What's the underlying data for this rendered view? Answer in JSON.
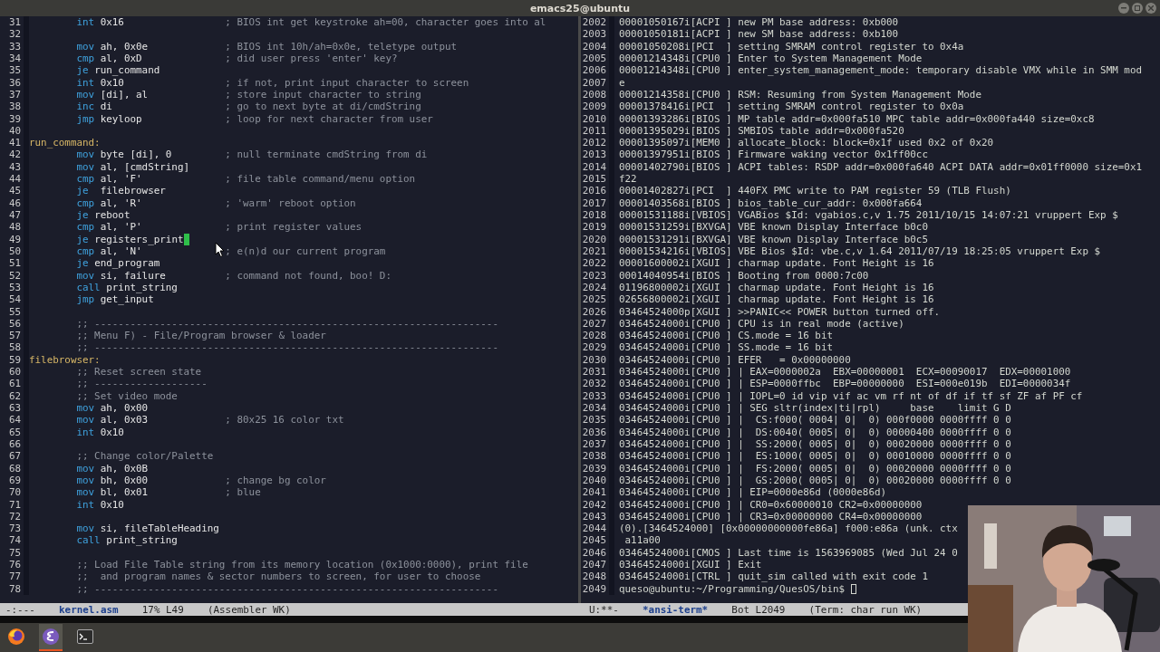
{
  "window": {
    "title": "emacs25@ubuntu"
  },
  "editor": {
    "lines": [
      {
        "n": "31",
        "kind": "code",
        "op": "int",
        "args": "0x16",
        "comment": "; BIOS int get keystroke ah=00, character goes into al"
      },
      {
        "n": "32",
        "kind": "blank"
      },
      {
        "n": "33",
        "kind": "code",
        "op": "mov",
        "args": "ah, 0x0e",
        "comment": "; BIOS int 10h/ah=0x0e, teletype output"
      },
      {
        "n": "34",
        "kind": "code",
        "op": "cmp",
        "args": "al, 0xD",
        "comment": "; did user press 'enter' key?"
      },
      {
        "n": "35",
        "kind": "code",
        "op": "je",
        "args": "run_command"
      },
      {
        "n": "36",
        "kind": "code",
        "op": "int",
        "args": "0x10",
        "comment": "; if not, print input character to screen"
      },
      {
        "n": "37",
        "kind": "code",
        "op": "mov",
        "args": "[di], al",
        "comment": "; store input character to string"
      },
      {
        "n": "38",
        "kind": "code",
        "op": "inc",
        "args": "di",
        "comment": "; go to next byte at di/cmdString"
      },
      {
        "n": "39",
        "kind": "code",
        "op": "jmp",
        "args": "keyloop",
        "comment": "; loop for next character from user"
      },
      {
        "n": "40",
        "kind": "blank"
      },
      {
        "n": "41",
        "kind": "label",
        "text": "run_command:"
      },
      {
        "n": "42",
        "kind": "code",
        "op": "mov",
        "args": "byte [di], 0",
        "comment": "; null terminate cmdString from di"
      },
      {
        "n": "43",
        "kind": "code",
        "op": "mov",
        "args": "al, [cmdString]"
      },
      {
        "n": "44",
        "kind": "code",
        "op": "cmp",
        "args": "al, 'F'",
        "comment": "; file table command/menu option"
      },
      {
        "n": "45",
        "kind": "code",
        "op": "je",
        "args": " filebrowser"
      },
      {
        "n": "46",
        "kind": "code",
        "op": "cmp",
        "args": "al, 'R'",
        "comment": "; 'warm' reboot option"
      },
      {
        "n": "47",
        "kind": "code",
        "op": "je",
        "args": "reboot"
      },
      {
        "n": "48",
        "kind": "code",
        "op": "cmp",
        "args": "al, 'P'",
        "comment": "; print register values"
      },
      {
        "n": "49",
        "kind": "code",
        "op": "je",
        "args": "registers_print",
        "cursor": true
      },
      {
        "n": "50",
        "kind": "code",
        "op": "cmp",
        "args": "al, 'N'",
        "comment": "; e(n)d our current program"
      },
      {
        "n": "51",
        "kind": "code",
        "op": "je",
        "args": "end_program"
      },
      {
        "n": "52",
        "kind": "code",
        "op": "mov",
        "args": "si, failure",
        "comment": "; command not found, boo! D:"
      },
      {
        "n": "53",
        "kind": "code",
        "op": "call",
        "args": "print_string"
      },
      {
        "n": "54",
        "kind": "code",
        "op": "jmp",
        "args": "get_input"
      },
      {
        "n": "55",
        "kind": "blank"
      },
      {
        "n": "56",
        "kind": "comment",
        "text": ";; --------------------------------------------------------------------"
      },
      {
        "n": "57",
        "kind": "comment",
        "text": ";; Menu F) - File/Program browser & loader"
      },
      {
        "n": "58",
        "kind": "comment",
        "text": ";; --------------------------------------------------------------------"
      },
      {
        "n": "59",
        "kind": "label",
        "text": "filebrowser:"
      },
      {
        "n": "60",
        "kind": "comment",
        "text": ";; Reset screen state"
      },
      {
        "n": "61",
        "kind": "comment",
        "text": ";; -------------------"
      },
      {
        "n": "62",
        "kind": "comment",
        "text": ";; Set video mode"
      },
      {
        "n": "63",
        "kind": "code",
        "op": "mov",
        "args": "ah, 0x00"
      },
      {
        "n": "64",
        "kind": "code",
        "op": "mov",
        "args": "al, 0x03",
        "comment": "; 80x25 16 color txt"
      },
      {
        "n": "65",
        "kind": "code",
        "op": "int",
        "args": "0x10"
      },
      {
        "n": "66",
        "kind": "blank"
      },
      {
        "n": "67",
        "kind": "comment",
        "text": ";; Change color/Palette"
      },
      {
        "n": "68",
        "kind": "code",
        "op": "mov",
        "args": "ah, 0x0B"
      },
      {
        "n": "69",
        "kind": "code",
        "op": "mov",
        "args": "bh, 0x00",
        "comment": "; change bg color"
      },
      {
        "n": "70",
        "kind": "code",
        "op": "mov",
        "args": "bl, 0x01",
        "comment": "; blue"
      },
      {
        "n": "71",
        "kind": "code",
        "op": "int",
        "args": "0x10"
      },
      {
        "n": "72",
        "kind": "blank"
      },
      {
        "n": "73",
        "kind": "code",
        "op": "mov",
        "args": "si, fileTableHeading"
      },
      {
        "n": "74",
        "kind": "code",
        "op": "call",
        "args": "print_string"
      },
      {
        "n": "75",
        "kind": "blank"
      },
      {
        "n": "76",
        "kind": "comment",
        "text": ";; Load File Table string from its memory location (0x1000:0000), print file"
      },
      {
        "n": "77",
        "kind": "comment",
        "text": ";;  and program names & sector numbers to screen, for user to choose"
      },
      {
        "n": "78",
        "kind": "comment",
        "text": ";; --------------------------------------------------------------------"
      }
    ],
    "mode_line": {
      "status": "-:---",
      "buffer": "kernel.asm",
      "position": "17% L49",
      "mode": "(Assembler WK)"
    }
  },
  "terminal": {
    "lines": [
      {
        "n": "2002",
        "text": "00001050167i[ACPI ] new PM base address: 0xb000"
      },
      {
        "n": "2003",
        "text": "00001050181i[ACPI ] new SM base address: 0xb100"
      },
      {
        "n": "2004",
        "text": "00001050208i[PCI  ] setting SMRAM control register to 0x4a"
      },
      {
        "n": "2005",
        "text": "00001214348i[CPU0 ] Enter to System Management Mode"
      },
      {
        "n": "2006",
        "text": "00001214348i[CPU0 ] enter_system_management_mode: temporary disable VMX while in SMM mod"
      },
      {
        "n": "2007",
        "text": "e"
      },
      {
        "n": "2008",
        "text": "00001214358i[CPU0 ] RSM: Resuming from System Management Mode"
      },
      {
        "n": "2009",
        "text": "00001378416i[PCI  ] setting SMRAM control register to 0x0a"
      },
      {
        "n": "2010",
        "text": "00001393286i[BIOS ] MP table addr=0x000fa510 MPC table addr=0x000fa440 size=0xc8"
      },
      {
        "n": "2011",
        "text": "00001395029i[BIOS ] SMBIOS table addr=0x000fa520"
      },
      {
        "n": "2012",
        "text": "00001395097i[MEM0 ] allocate_block: block=0x1f used 0x2 of 0x20"
      },
      {
        "n": "2013",
        "text": "00001397951i[BIOS ] Firmware waking vector 0x1ff00cc"
      },
      {
        "n": "2014",
        "text": "00001402790i[BIOS ] ACPI tables: RSDP addr=0x000fa640 ACPI DATA addr=0x01ff0000 size=0x1"
      },
      {
        "n": "2015",
        "text": "f22"
      },
      {
        "n": "2016",
        "text": "00001402827i[PCI  ] 440FX PMC write to PAM register 59 (TLB Flush)"
      },
      {
        "n": "2017",
        "text": "00001403568i[BIOS ] bios_table_cur_addr: 0x000fa664"
      },
      {
        "n": "2018",
        "text": "00001531188i[VBIOS] VGABios $Id: vgabios.c,v 1.75 2011/10/15 14:07:21 vruppert Exp $"
      },
      {
        "n": "2019",
        "text": "00001531259i[BXVGA] VBE known Display Interface b0c0"
      },
      {
        "n": "2020",
        "text": "00001531291i[BXVGA] VBE known Display Interface b0c5"
      },
      {
        "n": "2021",
        "text": "00001534216i[VBIOS] VBE Bios $Id: vbe.c,v 1.64 2011/07/19 18:25:05 vruppert Exp $"
      },
      {
        "n": "2022",
        "text": "00001600002i[XGUI ] charmap update. Font Height is 16"
      },
      {
        "n": "2023",
        "text": "00014040954i[BIOS ] Booting from 0000:7c00"
      },
      {
        "n": "2024",
        "text": "01196800002i[XGUI ] charmap update. Font Height is 16"
      },
      {
        "n": "2025",
        "text": "02656800002i[XGUI ] charmap update. Font Height is 16"
      },
      {
        "n": "2026",
        "text": "03464524000p[XGUI ] >>PANIC<< POWER button turned off."
      },
      {
        "n": "2027",
        "text": "03464524000i[CPU0 ] CPU is in real mode (active)"
      },
      {
        "n": "2028",
        "text": "03464524000i[CPU0 ] CS.mode = 16 bit"
      },
      {
        "n": "2029",
        "text": "03464524000i[CPU0 ] SS.mode = 16 bit"
      },
      {
        "n": "2030",
        "text": "03464524000i[CPU0 ] EFER   = 0x00000000"
      },
      {
        "n": "2031",
        "text": "03464524000i[CPU0 ] | EAX=0000002a  EBX=00000001  ECX=00090017  EDX=00001000"
      },
      {
        "n": "2032",
        "text": "03464524000i[CPU0 ] | ESP=0000ffbc  EBP=00000000  ESI=000e019b  EDI=0000034f"
      },
      {
        "n": "2033",
        "text": "03464524000i[CPU0 ] | IOPL=0 id vip vif ac vm rf nt of df if tf sf ZF af PF cf"
      },
      {
        "n": "2034",
        "text": "03464524000i[CPU0 ] | SEG sltr(index|ti|rpl)     base    limit G D"
      },
      {
        "n": "2035",
        "text": "03464524000i[CPU0 ] |  CS:f000( 0004| 0|  0) 000f0000 0000ffff 0 0"
      },
      {
        "n": "2036",
        "text": "03464524000i[CPU0 ] |  DS:0040( 0005| 0|  0) 00000400 0000ffff 0 0"
      },
      {
        "n": "2037",
        "text": "03464524000i[CPU0 ] |  SS:2000( 0005| 0|  0) 00020000 0000ffff 0 0"
      },
      {
        "n": "2038",
        "text": "03464524000i[CPU0 ] |  ES:1000( 0005| 0|  0) 00010000 0000ffff 0 0"
      },
      {
        "n": "2039",
        "text": "03464524000i[CPU0 ] |  FS:2000( 0005| 0|  0) 00020000 0000ffff 0 0"
      },
      {
        "n": "2040",
        "text": "03464524000i[CPU0 ] |  GS:2000( 0005| 0|  0) 00020000 0000ffff 0 0"
      },
      {
        "n": "2041",
        "text": "03464524000i[CPU0 ] | EIP=0000e86d (0000e86d)"
      },
      {
        "n": "2042",
        "text": "03464524000i[CPU0 ] | CR0=0x60000010 CR2=0x00000000"
      },
      {
        "n": "2043",
        "text": "03464524000i[CPU0 ] | CR3=0x00000000 CR4=0x00000000"
      },
      {
        "n": "2044",
        "text": "(0).[3464524000] [0x00000000000fe86a] f000:e86a (unk. ctx"
      },
      {
        "n": "2045",
        "text": " a11a00"
      },
      {
        "n": "2046",
        "text": "03464524000i[CMOS ] Last time is 1563969085 (Wed Jul 24 0"
      },
      {
        "n": "2047",
        "text": "03464524000i[XGUI ] Exit"
      },
      {
        "n": "2048",
        "text": "03464524000i[CTRL ] quit_sim called with exit code 1"
      },
      {
        "n": "2049",
        "text": "queso@ubuntu:~/Programming/QuesOS/bin$ ",
        "cursor": true
      }
    ],
    "mode_line": {
      "status": "U:**-",
      "buffer": "*ansi-term*",
      "position": "Bot L2049",
      "mode": "(Term: char run WK)"
    }
  },
  "taskbar": {
    "items": [
      {
        "kind": "browser",
        "selected": false
      },
      {
        "kind": "editor",
        "selected": true
      },
      {
        "kind": "terminal",
        "selected": false
      }
    ]
  }
}
